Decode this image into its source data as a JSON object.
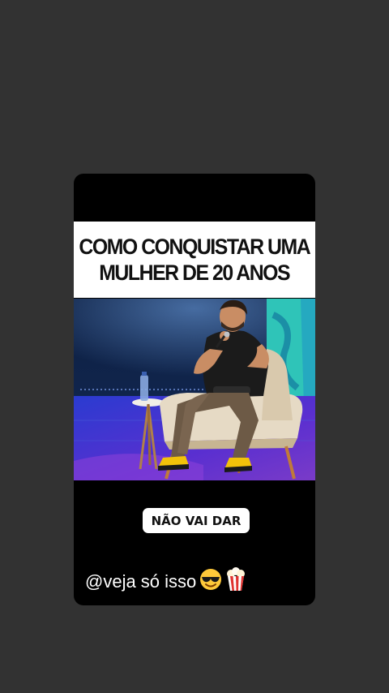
{
  "story": {
    "title_lines": [
      "COMO CONQUISTAR UMA",
      "MULHER DE 20 ANOS"
    ],
    "caption": "NÃO VAI DAR",
    "mention_text": "@veja só isso",
    "mention_emojis": [
      "smiling-face-with-sunglasses-icon",
      "popcorn-icon"
    ]
  },
  "colors": {
    "screen_background": "#323232",
    "card_background": "#000000",
    "title_band": "#ffffff",
    "stage_wall": "#0a1a3a",
    "stage_floor": "#3b2fb0",
    "right_panel": "#2fc4b8"
  }
}
